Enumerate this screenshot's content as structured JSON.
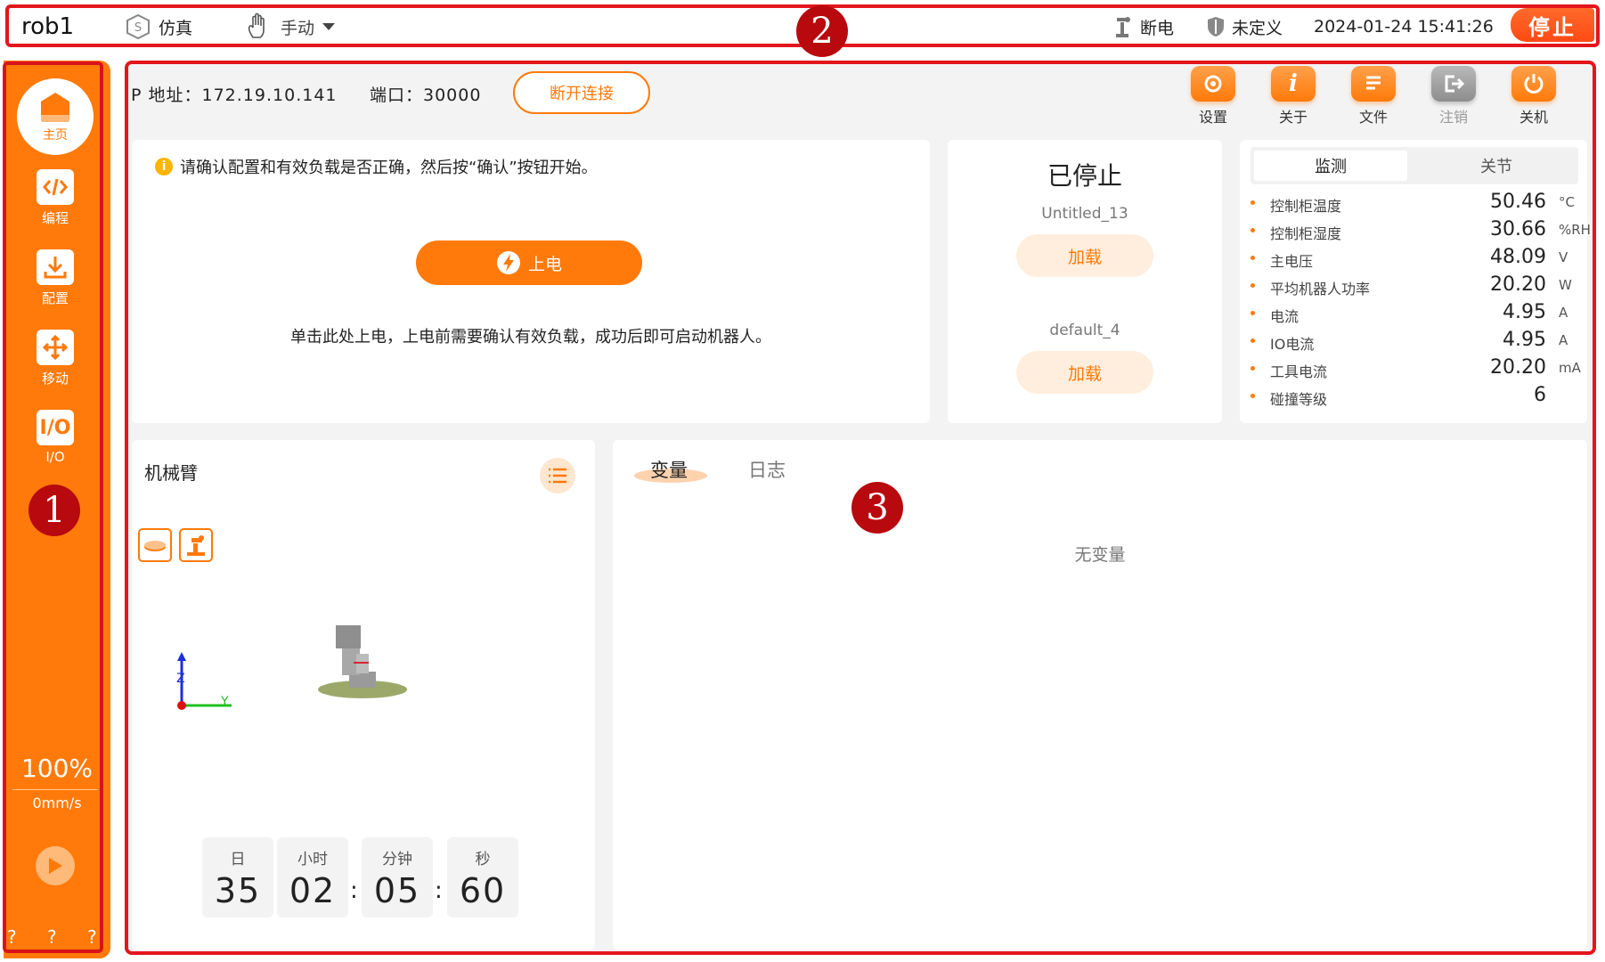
{
  "topbar": {
    "robot_name": "rob1",
    "mode_sim": "仿真",
    "mode_manual": "手动",
    "power_state": "断电",
    "tool_state": "未定义",
    "datetime": "2024-01-24 15:41:26",
    "stop_label": "停止"
  },
  "callouts": {
    "c1": "1",
    "c2": "2",
    "c3": "3"
  },
  "sidebar": {
    "home_label": "主页",
    "items": [
      {
        "label": "编程",
        "icon": "code-icon"
      },
      {
        "label": "配置",
        "icon": "download-icon"
      },
      {
        "label": "移动",
        "icon": "move-icon"
      },
      {
        "label": "I/O",
        "icon": "io-icon"
      }
    ],
    "speed_percent": "100%",
    "speed_value": "0mm/s",
    "status_marks": "? ? ? ?"
  },
  "connection": {
    "ip_text": "P 地址：172.19.10.141",
    "port_text": "端口：30000",
    "disconnect_label": "断开连接"
  },
  "toolbar": [
    {
      "label": "设置",
      "icon": "settings-icon"
    },
    {
      "label": "关于",
      "icon": "info-icon"
    },
    {
      "label": "文件",
      "icon": "file-icon"
    },
    {
      "label": "注销",
      "icon": "logout-icon"
    },
    {
      "label": "关机",
      "icon": "power-icon"
    }
  ],
  "notice": {
    "message": "请确认配置和有效负载是否正确，然后按“确认”按钮开始。",
    "power_on_label": "上电",
    "hint": "单击此处上电，上电前需要确认有效负载，成功后即可启动机器人。"
  },
  "program": {
    "state": "已停止",
    "program_name": "Untitled_13",
    "load_label": "加载",
    "payload_name": "default_4",
    "load_label_2": "加载"
  },
  "monitor": {
    "tabs": [
      "监测",
      "关节"
    ],
    "rows": [
      {
        "name": "控制柜温度",
        "value": "50.46",
        "unit": "°C"
      },
      {
        "name": "控制柜湿度",
        "value": "30.66",
        "unit": "%RH"
      },
      {
        "name": "主电压",
        "value": "48.09",
        "unit": "V"
      },
      {
        "name": "平均机器人功率",
        "value": "20.20",
        "unit": "W"
      },
      {
        "name": "电流",
        "value": "4.95",
        "unit": "A"
      },
      {
        "name": "IO电流",
        "value": "4.95",
        "unit": "A"
      },
      {
        "name": "工具电流",
        "value": "20.20",
        "unit": "mA"
      },
      {
        "name": "碰撞等级",
        "value": "6",
        "unit": ""
      }
    ]
  },
  "arm": {
    "title": "机械臂",
    "axis_z": "Z",
    "axis_y": "Y",
    "timer": [
      {
        "label": "日",
        "value": "35"
      },
      {
        "label": "小时",
        "value": "02"
      },
      {
        "label": "分钟",
        "value": "05"
      },
      {
        "label": "秒",
        "value": "60"
      }
    ],
    "sep": ":"
  },
  "variables": {
    "tabs": [
      "变量",
      "日志"
    ],
    "empty_text": "无变量"
  },
  "colors": {
    "accent": "#ff7a0a",
    "frame_red": "#e3161c",
    "callout": "#b8090e"
  }
}
